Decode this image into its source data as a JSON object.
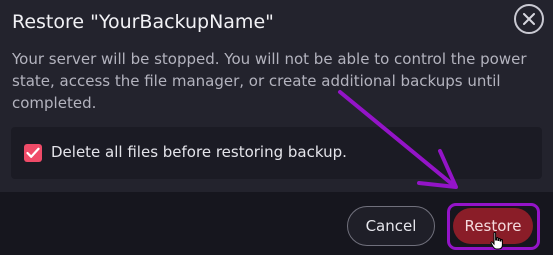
{
  "dialog": {
    "title": "Restore \"YourBackupName\"",
    "description": "Your server will be stopped. You will not be able to control the power state, access the file manager, or create additional backups until completed.",
    "option": {
      "label": "Delete all files before restoring backup.",
      "checked": true
    }
  },
  "buttons": {
    "cancel_label": "Cancel",
    "restore_label": "Restore"
  },
  "icons": {
    "close": "close-icon",
    "check": "check-icon",
    "cursor": "hand-pointer-icon"
  },
  "colors": {
    "accent": "#ef4b68",
    "restore_button": "#8a1d28",
    "annotation": "#9414c8"
  }
}
